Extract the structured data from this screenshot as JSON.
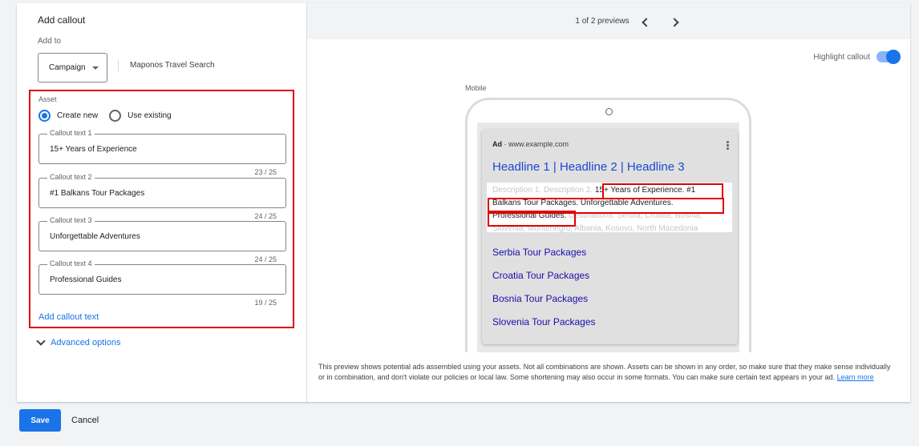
{
  "left": {
    "title": "Add callout",
    "add_to_label": "Add to",
    "campaign_button": "Campaign",
    "campaign_name": "Maponos Travel Search",
    "asset_label": "Asset",
    "radio_create_new": "Create new",
    "radio_use_existing": "Use existing",
    "radio_selected": "Create new",
    "fields": [
      {
        "label": "Callout text 1",
        "value": "15+ Years of Experience",
        "count": "23 / 25"
      },
      {
        "label": "Callout text 2",
        "value": "#1 Balkans Tour Packages",
        "count": "24 / 25"
      },
      {
        "label": "Callout text 3",
        "value": "Unforgettable Adventures",
        "count": "24 / 25"
      },
      {
        "label": "Callout text 4",
        "value": "Professional Guides",
        "count": "19 / 25"
      }
    ],
    "add_callout": "Add callout text",
    "advanced": "Advanced options"
  },
  "preview": {
    "page_indicator": "1 of 2 previews",
    "highlight_label": "Highlight callout",
    "highlight_on": true,
    "mobile_label": "Mobile",
    "ad_badge": "Ad",
    "ad_url": "· www.example.com",
    "headline": "Headline 1 | Headline 2 | Headline 3",
    "desc_pre": "Description 1. Description 2. ",
    "desc_callout_a": "15+ Years of Experience. #1",
    "desc_callout_b": "Balkans Tour Packages. Unforgettable Adventures.",
    "desc_callout_c": "Professional Guides.",
    "desc_post_a": " Destinations: Serbia, Croatia, Bosnia,",
    "desc_post_b": "Slovenia, Montenegro, Albania, Kosovo, North Macedonia",
    "sitelinks": [
      "Serbia Tour Packages",
      "Croatia Tour Packages",
      "Bosnia Tour Packages",
      "Slovenia Tour Packages"
    ],
    "disclaimer": "This preview shows potential ads assembled using your assets. Not all combinations are shown. Assets can be shown in any order, so make sure that they make sense individually or in combination, and don't violate our policies or local law. Some shortening may also occur in some formats. You can make sure certain text appears in your ad.",
    "learn_more": "Learn more"
  },
  "footer": {
    "save": "Save",
    "cancel": "Cancel"
  },
  "colors": {
    "accent": "#1a73e8",
    "highlight_border": "#e00000",
    "sitelink": "#1a0dab"
  }
}
